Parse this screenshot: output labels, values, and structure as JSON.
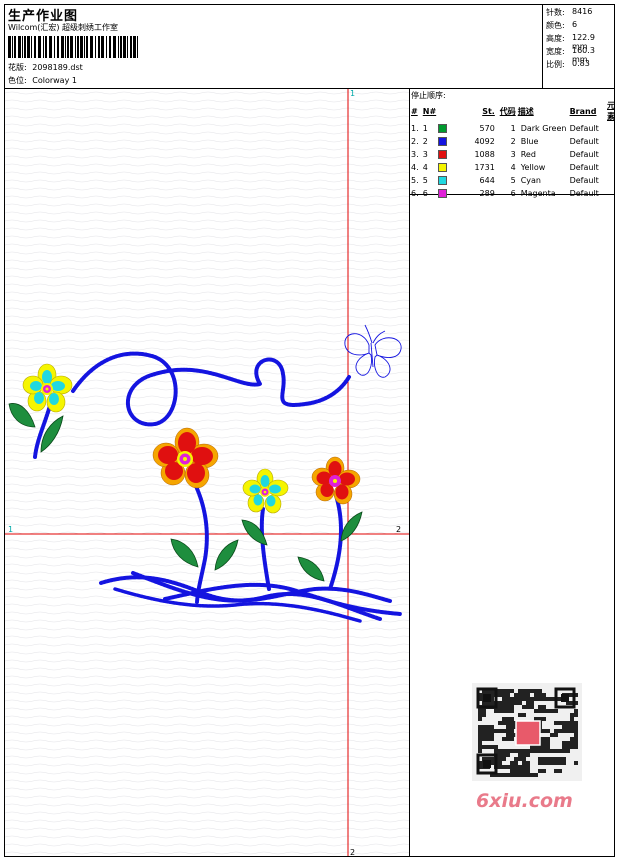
{
  "header": {
    "title": "生产作业图",
    "subtitle": "Wilcom(汇宏) 超级刺绣工作室",
    "pattern_label": "花版:",
    "pattern_value": "2098189.dst",
    "colorway_label": "色位:",
    "colorway_value": "Colorway 1"
  },
  "specs": [
    {
      "label": "针数:",
      "value": "8416"
    },
    {
      "label": "颜色:",
      "value": "6"
    },
    {
      "label": "高度:",
      "value": "122.9 mm"
    },
    {
      "label": "宽度:",
      "value": "160.3 mm"
    },
    {
      "label": "比例:",
      "value": "0.83"
    }
  ],
  "stop_sequence": {
    "title": "停止顺序:",
    "columns": [
      "#",
      "N#",
      "St.",
      "代码",
      "描述",
      "Brand",
      "元素"
    ],
    "rows": [
      {
        "num": "1.",
        "n": "1",
        "color": "#009A2E",
        "st": "570",
        "code": "1",
        "desc": "Dark Green",
        "brand": "Default"
      },
      {
        "num": "2.",
        "n": "2",
        "color": "#1414E0",
        "st": "4092",
        "code": "2",
        "desc": "Blue",
        "brand": "Default"
      },
      {
        "num": "3.",
        "n": "3",
        "color": "#E01010",
        "st": "1088",
        "code": "3",
        "desc": "Red",
        "brand": "Default"
      },
      {
        "num": "4.",
        "n": "4",
        "color": "#F5F500",
        "st": "1731",
        "code": "4",
        "desc": "Yellow",
        "brand": "Default"
      },
      {
        "num": "5.",
        "n": "5",
        "color": "#20D8E0",
        "st": "644",
        "code": "5",
        "desc": "Cyan",
        "brand": "Default"
      },
      {
        "num": "6.",
        "n": "6",
        "color": "#E020D8",
        "st": "289",
        "code": "6",
        "desc": "Magenta",
        "brand": "Default"
      }
    ]
  },
  "axis_labels": {
    "top": "1",
    "bottom": "2",
    "left": "1",
    "right": "2"
  },
  "watermark": "6xiu.com",
  "colors": {
    "guide": "#E00000",
    "axis_label": "#00A8A8",
    "thread_blue": "#1414E0"
  }
}
